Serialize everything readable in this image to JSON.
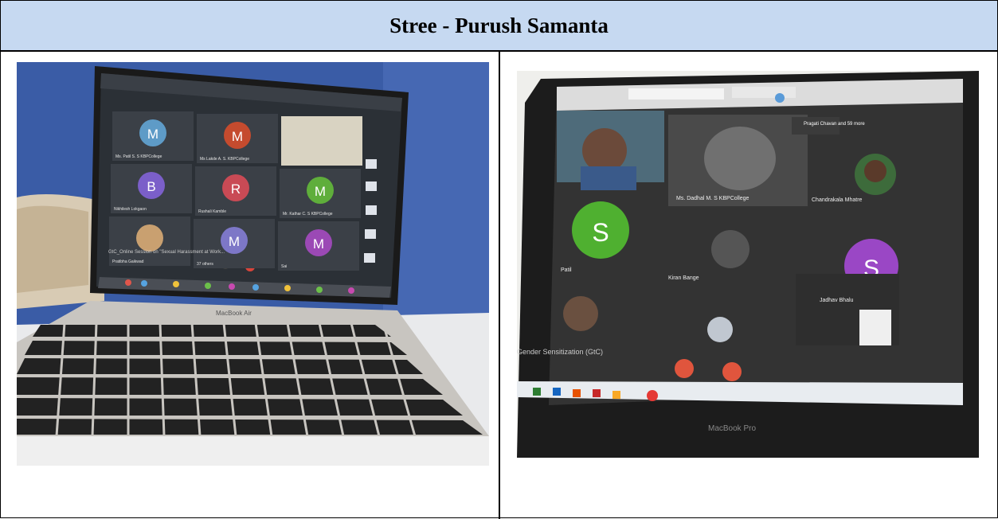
{
  "document": {
    "title": "Stree - Purush Samanta"
  },
  "photos": [
    {
      "name": "left",
      "laptop_label": "MacBook Air",
      "meeting_caption": "GtC_Online Session on \"Sexual Harassment at Work...",
      "participants": [
        {
          "initial": "M",
          "color": "#5e9bc7",
          "label": "Ms. Patil S. S KBPCollege"
        },
        {
          "initial": "M",
          "color": "#c54b2e",
          "label": "Ms Lakde A. S. KBPCollege"
        },
        {
          "initial": "",
          "color": "#7d8a7d",
          "label": ""
        },
        {
          "initial": "B",
          "color": "#7b5fc9",
          "label": "Nikhilesh Lokgaon"
        },
        {
          "initial": "R",
          "color": "#c94a55",
          "label": "Rushali Kamble"
        },
        {
          "initial": "M",
          "color": "#5fae3b",
          "label": "Mr. Kathar C. S KBPCollege"
        },
        {
          "initial": "",
          "color": "#c9a070",
          "label": "Pratibha Gaikwad"
        },
        {
          "initial": "M",
          "color": "#7d77c7",
          "label": "37 others"
        },
        {
          "initial": "M",
          "color": "#9b49b5",
          "label": "Sai"
        }
      ]
    },
    {
      "name": "right",
      "laptop_label": "MacBook Pro",
      "meeting_caption": "Gender Sensitization (GtC)",
      "participants": [
        {
          "initial": "",
          "color": "#6a6a6a",
          "label": ""
        },
        {
          "initial": "",
          "color": "#5a5a5a",
          "label": "Ms. Dadhal M. S KBPCollege"
        },
        {
          "initial": "",
          "color": "#2f2f2f",
          "label": "Chandrakala Mhatre"
        },
        {
          "initial": "S",
          "color": "#4fb030",
          "label": "Patil"
        },
        {
          "initial": "",
          "color": "#3a3a3a",
          "label": "Kiran Bange"
        },
        {
          "initial": "S",
          "color": "#9a47c5",
          "label": "Jadhav Bhalu"
        }
      ],
      "presenter_name": "Pragati Chavan and 59 more"
    }
  ]
}
